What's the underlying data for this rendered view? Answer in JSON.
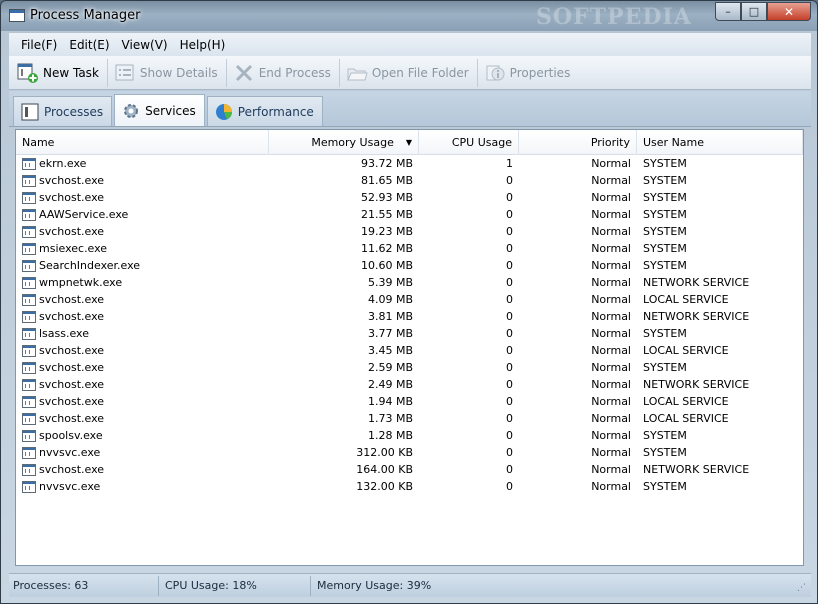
{
  "window": {
    "title": "Process Manager",
    "watermark": "SOFTPEDIA",
    "controls": {
      "minimize": "–",
      "maximize": "□",
      "close": "✕"
    }
  },
  "menu": [
    {
      "label": "File(F)"
    },
    {
      "label": "Edit(E)"
    },
    {
      "label": "View(V)"
    },
    {
      "label": "Help(H)"
    }
  ],
  "toolbar": {
    "new_task": "New Task",
    "show_details": "Show Details",
    "end_process": "End Process",
    "open_file_folder": "Open File Folder",
    "properties": "Properties"
  },
  "tabs": [
    {
      "label": "Processes"
    },
    {
      "label": "Services"
    },
    {
      "label": "Performance"
    }
  ],
  "active_tab": "Services",
  "columns": {
    "name": "Name",
    "memory": "Memory Usage",
    "cpu": "CPU Usage",
    "priority": "Priority",
    "user": "User Name"
  },
  "rows": [
    {
      "name": "ekrn.exe",
      "memory": "93.72 MB",
      "cpu": "1",
      "priority": "Normal",
      "user": "SYSTEM"
    },
    {
      "name": "svchost.exe",
      "memory": "81.65 MB",
      "cpu": "0",
      "priority": "Normal",
      "user": "SYSTEM"
    },
    {
      "name": "svchost.exe",
      "memory": "52.93 MB",
      "cpu": "0",
      "priority": "Normal",
      "user": "SYSTEM"
    },
    {
      "name": "AAWService.exe",
      "memory": "21.55 MB",
      "cpu": "0",
      "priority": "Normal",
      "user": "SYSTEM"
    },
    {
      "name": "svchost.exe",
      "memory": "19.23 MB",
      "cpu": "0",
      "priority": "Normal",
      "user": "SYSTEM"
    },
    {
      "name": "msiexec.exe",
      "memory": "11.62 MB",
      "cpu": "0",
      "priority": "Normal",
      "user": "SYSTEM"
    },
    {
      "name": "SearchIndexer.exe",
      "memory": "10.60 MB",
      "cpu": "0",
      "priority": "Normal",
      "user": "SYSTEM"
    },
    {
      "name": "wmpnetwk.exe",
      "memory": "5.39 MB",
      "cpu": "0",
      "priority": "Normal",
      "user": "NETWORK SERVICE"
    },
    {
      "name": "svchost.exe",
      "memory": "4.09 MB",
      "cpu": "0",
      "priority": "Normal",
      "user": "LOCAL SERVICE"
    },
    {
      "name": "svchost.exe",
      "memory": "3.81 MB",
      "cpu": "0",
      "priority": "Normal",
      "user": "NETWORK SERVICE"
    },
    {
      "name": "lsass.exe",
      "memory": "3.77 MB",
      "cpu": "0",
      "priority": "Normal",
      "user": "SYSTEM"
    },
    {
      "name": "svchost.exe",
      "memory": "3.45 MB",
      "cpu": "0",
      "priority": "Normal",
      "user": "LOCAL SERVICE"
    },
    {
      "name": "svchost.exe",
      "memory": "2.59 MB",
      "cpu": "0",
      "priority": "Normal",
      "user": "SYSTEM"
    },
    {
      "name": "svchost.exe",
      "memory": "2.49 MB",
      "cpu": "0",
      "priority": "Normal",
      "user": "NETWORK SERVICE"
    },
    {
      "name": "svchost.exe",
      "memory": "1.94 MB",
      "cpu": "0",
      "priority": "Normal",
      "user": "LOCAL SERVICE"
    },
    {
      "name": "svchost.exe",
      "memory": "1.73 MB",
      "cpu": "0",
      "priority": "Normal",
      "user": "LOCAL SERVICE"
    },
    {
      "name": "spoolsv.exe",
      "memory": "1.28 MB",
      "cpu": "0",
      "priority": "Normal",
      "user": "SYSTEM"
    },
    {
      "name": "nvvsvc.exe",
      "memory": "312.00 KB",
      "cpu": "0",
      "priority": "Normal",
      "user": "SYSTEM"
    },
    {
      "name": "svchost.exe",
      "memory": "164.00 KB",
      "cpu": "0",
      "priority": "Normal",
      "user": "NETWORK SERVICE"
    },
    {
      "name": "nvvsvc.exe",
      "memory": "132.00 KB",
      "cpu": "0",
      "priority": "Normal",
      "user": "SYSTEM"
    }
  ],
  "status": {
    "processes": "Processes: 63",
    "cpu": "CPU Usage: 18%",
    "memory": "Memory Usage: 39%"
  }
}
